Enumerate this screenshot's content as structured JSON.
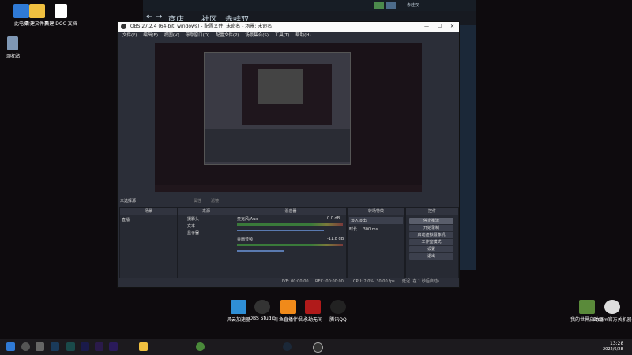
{
  "desktop": {
    "icons": [
      {
        "label": "此电脑"
      },
      {
        "label": "新建文件夹"
      },
      {
        "label": "新建 DOC 文档"
      },
      {
        "label": "回收站"
      }
    ],
    "shortcuts": [
      {
        "label": "风云加速器"
      },
      {
        "label": "OBS Studio"
      },
      {
        "label": "斗鱼直播伴侣"
      },
      {
        "label": "永劫无间"
      },
      {
        "label": "腾讯QQ"
      },
      {
        "label": "我的世界启动器"
      },
      {
        "label": "Steam官方关机器"
      }
    ]
  },
  "steam": {
    "nav_items": [
      "商店",
      "社区",
      "赤蛙双"
    ],
    "user_label": "赤蛙双"
  },
  "obs": {
    "title": "OBS 27.2.4 (64-bit, windows) - 配置文件: 未命名 - 场景: 未命名",
    "menu": [
      "文件(F)",
      "编辑(E)",
      "视图(V)",
      "停靠窗口(D)",
      "配置文件(P)",
      "场景集合(S)",
      "工具(T)",
      "帮助(H)"
    ],
    "source_bar": {
      "label": "未选择源",
      "properties": "属性",
      "filters": "滤镜"
    },
    "panels": {
      "scenes": {
        "title": "场景",
        "items": [
          "直播"
        ]
      },
      "sources": {
        "title": "来源",
        "items": [
          "摄影头",
          "文本",
          "显示器"
        ]
      },
      "mixer": {
        "title": "混音器",
        "tracks": [
          {
            "name": "麦克风/Aux",
            "db": "0.0 dB"
          },
          {
            "name": "桌面音频",
            "db": "-11.8 dB"
          }
        ]
      },
      "transitions": {
        "title": "转场特效",
        "mode": "淡入淡出",
        "duration_label": "时长",
        "duration": "300 ms"
      },
      "controls": {
        "title": "控件",
        "buttons": [
          "停止推流",
          "开始录制",
          "启动虚拟摄像机",
          "工作室模式",
          "设置",
          "退出"
        ]
      }
    },
    "status": {
      "live": "LIVE: 00:00:00",
      "rec": "REC: 00:00:00",
      "cpu": "CPU: 2.0%, 30.00 fps",
      "dropped": "延迟 (在 1 秒后启动)"
    }
  },
  "taskbar": {
    "time": "13:28",
    "date": "2022/6/28"
  }
}
